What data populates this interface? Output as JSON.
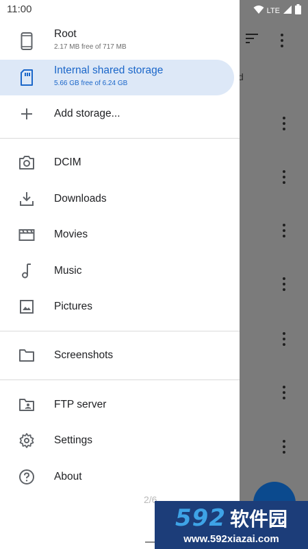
{
  "status_bar": {
    "time": "11:00",
    "network": "LTE",
    "icons": [
      "wifi-icon",
      "signal-icon",
      "battery-icon"
    ]
  },
  "drawer": {
    "storage": [
      {
        "label": "Root",
        "sub": "2.17 MB free of 717 MB",
        "icon": "phone-icon"
      },
      {
        "label": "Internal shared storage",
        "sub": "5.66 GB free of 6.24 GB",
        "icon": "sd-card-icon",
        "selected": true
      },
      {
        "label": "Add storage...",
        "icon": "plus-icon"
      }
    ],
    "folders": [
      {
        "label": "DCIM",
        "icon": "camera-icon"
      },
      {
        "label": "Downloads",
        "icon": "download-icon"
      },
      {
        "label": "Movies",
        "icon": "movie-icon"
      },
      {
        "label": "Music",
        "icon": "music-note-icon"
      },
      {
        "label": "Pictures",
        "icon": "image-icon"
      }
    ],
    "extra": [
      {
        "label": "Screenshots",
        "icon": "folder-icon"
      }
    ],
    "tools": [
      {
        "label": "FTP server",
        "icon": "folder-shared-icon"
      },
      {
        "label": "Settings",
        "icon": "gear-icon"
      },
      {
        "label": "About",
        "icon": "help-icon"
      }
    ]
  },
  "background": {
    "partial_text": "d",
    "pager": "2/6"
  },
  "watermark": {
    "number": "592",
    "brand": "软件园",
    "url": "www.592xiazai.com"
  },
  "colors": {
    "accent": "#1a66c9",
    "selected_bg": "#dde8f7",
    "scrim": "#7b7b7b",
    "fab": "#0b4a8e",
    "watermark_bg": "#1c3d79"
  }
}
